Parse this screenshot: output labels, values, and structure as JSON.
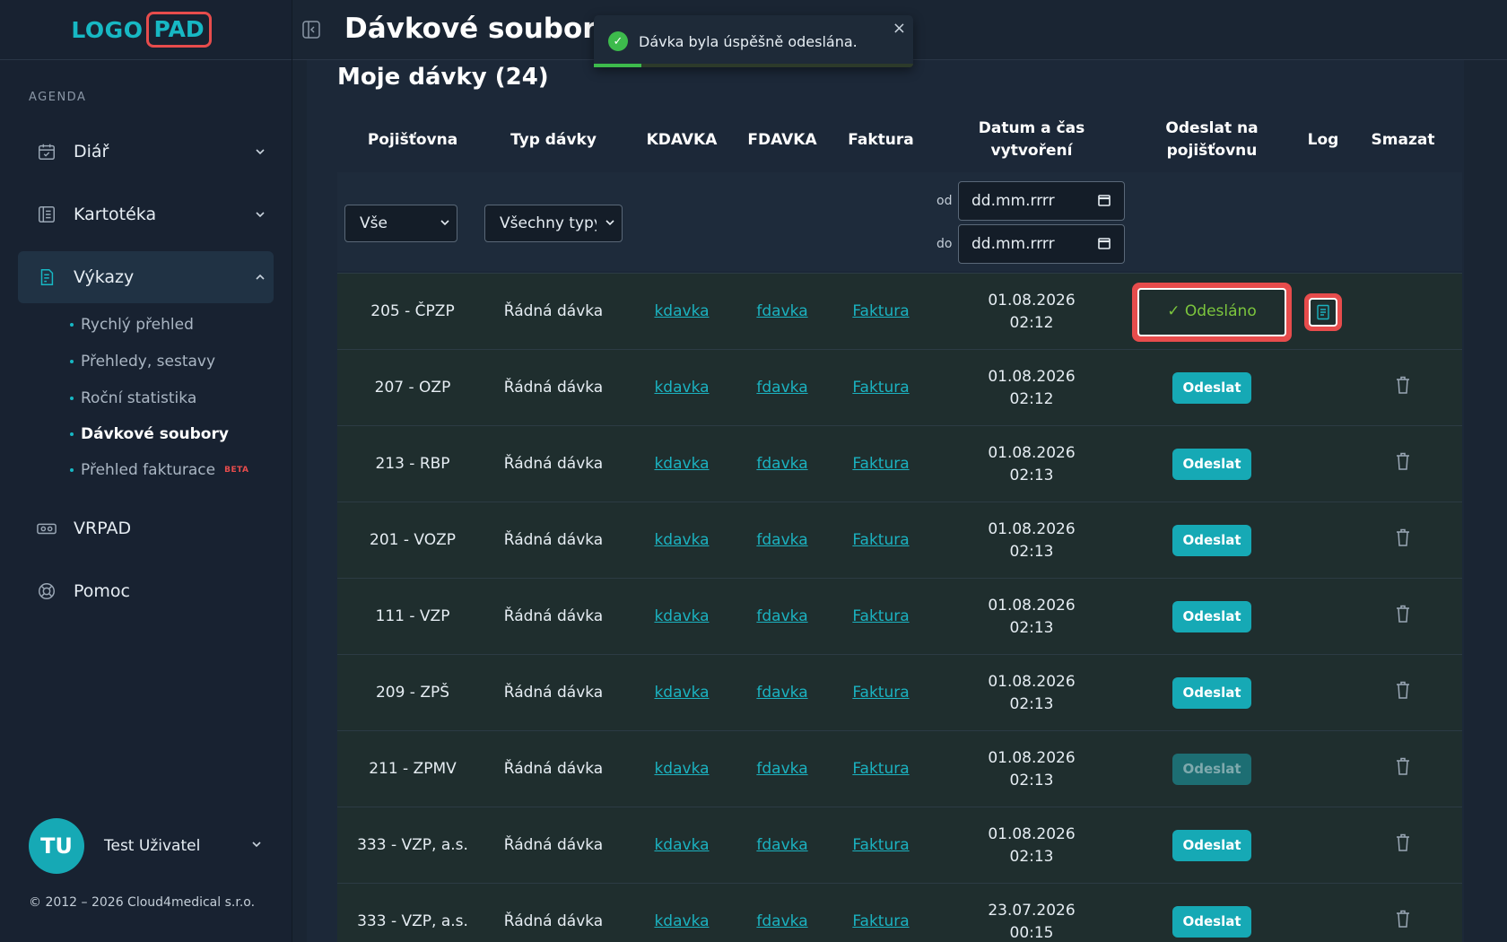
{
  "logo": {
    "left": "LOGO",
    "right": "PAD"
  },
  "sidebar": {
    "section_label": "AGENDA",
    "items": [
      {
        "label": "Diář",
        "icon": "calendar-icon"
      },
      {
        "label": "Kartotéka",
        "icon": "cards-icon"
      },
      {
        "label": "Výkazy",
        "icon": "report-icon"
      },
      {
        "label": "VRPAD",
        "icon": "vr-icon"
      },
      {
        "label": "Pomoc",
        "icon": "lifebuoy-icon"
      }
    ],
    "subitems": [
      {
        "label": "Rychlý přehled"
      },
      {
        "label": "Přehledy, sestavy"
      },
      {
        "label": "Roční statistika"
      },
      {
        "label": "Dávkové soubory"
      },
      {
        "label": "Přehled fakturace",
        "badge": "BETA"
      }
    ],
    "user": {
      "initials": "TU",
      "name": "Test Uživatel"
    },
    "copyright": "© 2012 – 2026 Cloud4medical s.r.o."
  },
  "header": {
    "title": "Dávkové soubory"
  },
  "toast": {
    "message": "Dávka byla úspěšně odeslána.",
    "close": "×",
    "progress": 0.15
  },
  "main": {
    "section_title": "Moje dávky (24)",
    "columns": [
      "Pojišťovna",
      "Typ dávky",
      "KDAVKA",
      "FDAVKA",
      "Faktura",
      "Datum a čas vytvoření",
      "Odeslat na pojišťovnu",
      "Log",
      "Smazat"
    ],
    "filters": {
      "insurer": "Vše",
      "type": "Všechny typy",
      "from_label": "od",
      "to_label": "do",
      "from_placeholder": "dd.mm.rrrr",
      "to_placeholder": "dd.mm.rrrr"
    },
    "rows": [
      {
        "insurer": "205 - ČPZP",
        "type": "Řádná dávka",
        "kdavka": "kdavka",
        "fdavka": "fdavka",
        "faktura": "Faktura",
        "date": "01.08.2026",
        "time": "02:12",
        "status": "sent",
        "action": "✓ Odesláno"
      },
      {
        "insurer": "207 - OZP",
        "type": "Řádná dávka",
        "kdavka": "kdavka",
        "fdavka": "fdavka",
        "faktura": "Faktura",
        "date": "01.08.2026",
        "time": "02:12",
        "status": "send",
        "action": "Odeslat"
      },
      {
        "insurer": "213 - RBP",
        "type": "Řádná dávka",
        "kdavka": "kdavka",
        "fdavka": "fdavka",
        "faktura": "Faktura",
        "date": "01.08.2026",
        "time": "02:13",
        "status": "send",
        "action": "Odeslat"
      },
      {
        "insurer": "201 - VOZP",
        "type": "Řádná dávka",
        "kdavka": "kdavka",
        "fdavka": "fdavka",
        "faktura": "Faktura",
        "date": "01.08.2026",
        "time": "02:13",
        "status": "send",
        "action": "Odeslat"
      },
      {
        "insurer": "111 - VZP",
        "type": "Řádná dávka",
        "kdavka": "kdavka",
        "fdavka": "fdavka",
        "faktura": "Faktura",
        "date": "01.08.2026",
        "time": "02:13",
        "status": "send",
        "action": "Odeslat"
      },
      {
        "insurer": "209 - ZPŠ",
        "type": "Řádná dávka",
        "kdavka": "kdavka",
        "fdavka": "fdavka",
        "faktura": "Faktura",
        "date": "01.08.2026",
        "time": "02:13",
        "status": "send",
        "action": "Odeslat"
      },
      {
        "insurer": "211 - ZPMV",
        "type": "Řádná dávka",
        "kdavka": "kdavka",
        "fdavka": "fdavka",
        "faktura": "Faktura",
        "date": "01.08.2026",
        "time": "02:13",
        "status": "disabled",
        "action": "Odeslat"
      },
      {
        "insurer": "333 - VZP, a.s.",
        "type": "Řádná dávka",
        "kdavka": "kdavka",
        "fdavka": "fdavka",
        "faktura": "Faktura",
        "date": "01.08.2026",
        "time": "02:13",
        "status": "send",
        "action": "Odeslat"
      },
      {
        "insurer": "333 - VZP, a.s.",
        "type": "Řádná dávka",
        "kdavka": "kdavka",
        "fdavka": "fdavka",
        "faktura": "Faktura",
        "date": "23.07.2026",
        "time": "00:15",
        "status": "send",
        "action": "Odeslat"
      }
    ]
  },
  "colors": {
    "accent": "#16a9b5",
    "highlight": "#e74c4c",
    "success": "#3dbb4c",
    "sent_text": "#7cc63d"
  }
}
